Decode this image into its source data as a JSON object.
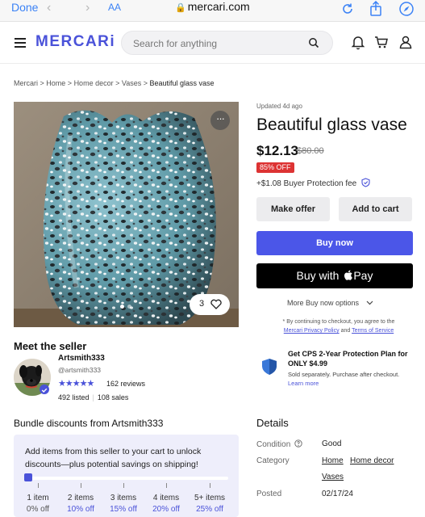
{
  "browser": {
    "done_label": "Done",
    "aa_label": "AA",
    "url": "mercari.com"
  },
  "header": {
    "logo": "MERCARi",
    "search_placeholder": "Search for anything"
  },
  "breadcrumb": {
    "items": [
      "Mercari",
      "Home",
      "Home decor",
      "Vases"
    ],
    "current": "Beautiful glass vase"
  },
  "product": {
    "updated": "Updated 4d ago",
    "title": "Beautiful glass vase",
    "price": "$12.13",
    "original_price": "$80.00",
    "discount_badge": "85% OFF",
    "fee_text": "+$1.08 Buyer Protection fee",
    "like_count": "3",
    "image_pages": 2,
    "image_current_page": 1
  },
  "actions": {
    "make_offer": "Make offer",
    "add_to_cart": "Add to cart",
    "buy_now": "Buy now",
    "buy_with": "Buy with",
    "pay_label": "Pay",
    "more_options": "More Buy now options",
    "legal_prefix": "* By continuing to checkout, you agree to the",
    "privacy_link": "Mercari Privacy Policy",
    "legal_and": "and",
    "terms_link": "Terms of Service"
  },
  "protection": {
    "title": "Get CPS 2-Year Protection Plan for ONLY $4.99",
    "subtitle": "Sold separately. Purchase after checkout.",
    "learn_more": "Learn more"
  },
  "seller": {
    "heading": "Meet the seller",
    "name": "Artsmith333",
    "handle": "@artsmith333",
    "stars": "★★★★★",
    "reviews": "162 reviews",
    "listed": "492 listed",
    "sales": "108 sales"
  },
  "bundle": {
    "heading": "Bundle discounts from Artsmith333",
    "message": "Add items from this seller to your cart to unlock discounts—plus potential savings on shipping!",
    "tiers": [
      {
        "items": "1 item",
        "discount": "0% off"
      },
      {
        "items": "2 items",
        "discount": "10% off"
      },
      {
        "items": "3 items",
        "discount": "15% off"
      },
      {
        "items": "4 items",
        "discount": "20% off"
      },
      {
        "items": "5+ items",
        "discount": "25% off"
      }
    ]
  },
  "details": {
    "heading": "Details",
    "condition_label": "Condition",
    "condition_value": "Good",
    "category_label": "Category",
    "category_1": "Home",
    "category_2": "Home decor",
    "category_3": "Vases",
    "posted_label": "Posted",
    "posted_value": "02/17/24"
  },
  "colors": {
    "accent": "#4a52d9",
    "buy_now": "#4b56e8",
    "badge": "#dd3333",
    "ios_blue": "#3b82f6"
  },
  "icons": [
    "lock-icon",
    "refresh-icon",
    "share-icon",
    "compass-icon",
    "menu-icon",
    "search-icon",
    "bell-icon",
    "cart-icon",
    "user-icon",
    "more-dots-icon",
    "heart-icon",
    "shield-icon",
    "apple-icon",
    "chevron-down-icon",
    "info-icon"
  ]
}
